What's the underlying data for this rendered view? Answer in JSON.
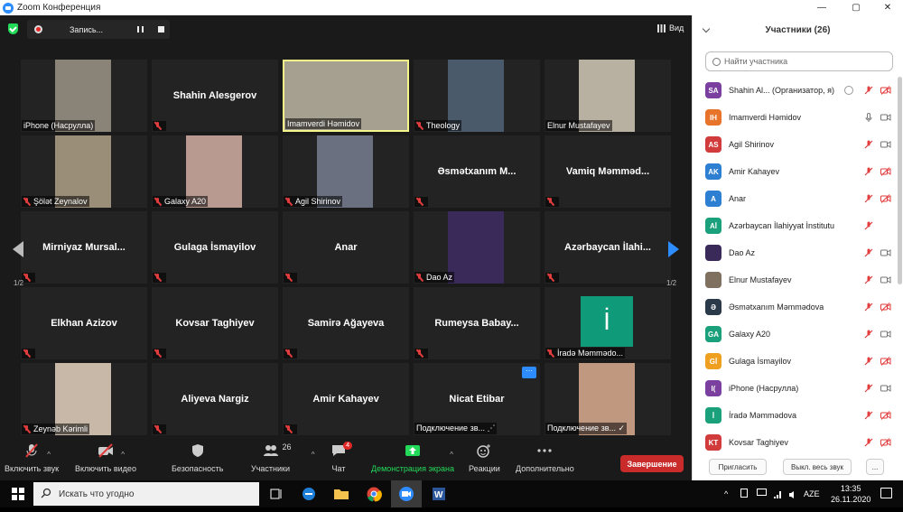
{
  "window": {
    "title": "Zoom Конференция"
  },
  "topbar": {
    "record_label": "Запись...",
    "view_label": "Вид"
  },
  "pager": {
    "left": "1/2",
    "right": "1/2"
  },
  "tiles": [
    {
      "name": "",
      "label": "iPhone (Насрулла)",
      "muted": false,
      "video": "#8a8378"
    },
    {
      "name": "Shahin Alesgerov",
      "label": "",
      "muted": true
    },
    {
      "name": "",
      "label": "Imamverdi Həmidov",
      "muted": false,
      "video": "#a6a090",
      "active": true
    },
    {
      "name": "",
      "label": "Theology",
      "muted": true,
      "video": "#4a5a6a"
    },
    {
      "name": "",
      "label": "Elnur Mustafayev",
      "muted": false,
      "video": "#b8b0a0"
    },
    {
      "name": "",
      "label": "Şölət Zeynalov",
      "muted": true,
      "video": "#9b8e78"
    },
    {
      "name": "",
      "label": "Galaxy A20",
      "muted": true,
      "video": "#b89a90"
    },
    {
      "name": "",
      "label": "Agil Shirinov",
      "muted": true,
      "video": "#6a7080"
    },
    {
      "name": "Əsmətxanım  M...",
      "label": "",
      "muted": true
    },
    {
      "name": "Vamiq  Məmməd...",
      "label": "",
      "muted": true
    },
    {
      "name": "Mirniyaz  Mursal...",
      "label": "",
      "muted": true
    },
    {
      "name": "Gulaga İsmayilov",
      "label": "",
      "muted": true
    },
    {
      "name": "Anar",
      "label": "",
      "muted": true
    },
    {
      "name": "",
      "label": "Dao Az",
      "muted": true,
      "video": "#3a2a5a"
    },
    {
      "name": "Azərbaycan  İlahi...",
      "label": "",
      "muted": true
    },
    {
      "name": "Elkhan Azizov",
      "label": "",
      "muted": true
    },
    {
      "name": "Kovsar Taghiyev",
      "label": "",
      "muted": true
    },
    {
      "name": "Samirə Ağayeva",
      "label": "",
      "muted": true
    },
    {
      "name": "Rumeysa  Babay...",
      "label": "",
      "muted": true
    },
    {
      "name": "",
      "label": "İradə Məmmədo...",
      "muted": true,
      "video": "#0f9a7a",
      "initial": "İ"
    },
    {
      "name": "",
      "label": "Zeynəb Kərimli",
      "muted": true,
      "video": "#c8b8a8"
    },
    {
      "name": "Aliyeva Nargiz",
      "label": "",
      "muted": true
    },
    {
      "name": "Amir Kahayev",
      "label": "",
      "muted": true
    },
    {
      "name": "Nicat Etibar",
      "label": "Подключение зв... ⋰",
      "muted": false,
      "dots": "···"
    },
    {
      "name": "",
      "label": "Подключение зв... ✓",
      "muted": false,
      "video": "#c09880"
    }
  ],
  "toolbar": {
    "audio": "Включить звук",
    "video": "Включить видео",
    "security": "Безопасность",
    "participants": "Участники",
    "participants_count": "26",
    "chat": "Чат",
    "chat_badge": "4",
    "share": "Демонстрация экрана",
    "reactions": "Реакции",
    "more": "Дополнительно",
    "end": "Завершение"
  },
  "panel": {
    "title": "Участники (26)",
    "search_placeholder": "Найти участника",
    "invite": "Пригласить",
    "mute_all": "Выкл. весь звук",
    "more": "...",
    "participants": [
      {
        "initials": "SA",
        "name": "Shahin Al... (Организатор, я)",
        "color": "#7b3fa0",
        "mic": "off",
        "cam": "off",
        "host": true
      },
      {
        "initials": "IH",
        "name": "Imamverdi Həmidov",
        "color": "#e8732a",
        "mic": "on",
        "cam": "on"
      },
      {
        "initials": "AS",
        "name": "Agil Shirinov",
        "color": "#d13b3b",
        "mic": "off",
        "cam": "on"
      },
      {
        "initials": "AK",
        "name": "Amir Kahayev",
        "color": "#2d7fd1",
        "mic": "off",
        "cam": "off"
      },
      {
        "initials": "A",
        "name": "Anar",
        "color": "#2d7fd1",
        "mic": "off",
        "cam": "off"
      },
      {
        "initials": "Aİ",
        "name": "Azərbaycan İlahiyyat İnstitutu",
        "color": "#1aa07a",
        "mic": "off",
        "cam": "none"
      },
      {
        "initials": "",
        "name": "Dao Az",
        "color": "#3a2a5a",
        "mic": "off",
        "cam": "on"
      },
      {
        "initials": "",
        "name": "Elnur Mustafayev",
        "color": "#807060",
        "mic": "off",
        "cam": "on"
      },
      {
        "initials": "Ə",
        "name": "Əsmətxanım Məmmədova",
        "color": "#2a3a4a",
        "mic": "off",
        "cam": "off"
      },
      {
        "initials": "GA",
        "name": "Galaxy A20",
        "color": "#1aa07a",
        "mic": "off",
        "cam": "on"
      },
      {
        "initials": "Gİ",
        "name": "Gulaga İsmayilov",
        "color": "#f0a020",
        "mic": "off",
        "cam": "off"
      },
      {
        "initials": "I(",
        "name": "iPhone (Насрулла)",
        "color": "#7b3fa0",
        "mic": "off",
        "cam": "on"
      },
      {
        "initials": "İ",
        "name": "İradə Məmmədova",
        "color": "#1aa07a",
        "mic": "off",
        "cam": "off"
      },
      {
        "initials": "KT",
        "name": "Kovsar Taghiyev",
        "color": "#d13b3b",
        "mic": "off",
        "cam": "off"
      }
    ]
  },
  "taskbar": {
    "search_placeholder": "Искать что угодно",
    "lang": "AZE",
    "time": "13:35",
    "date": "26.11.2020"
  }
}
